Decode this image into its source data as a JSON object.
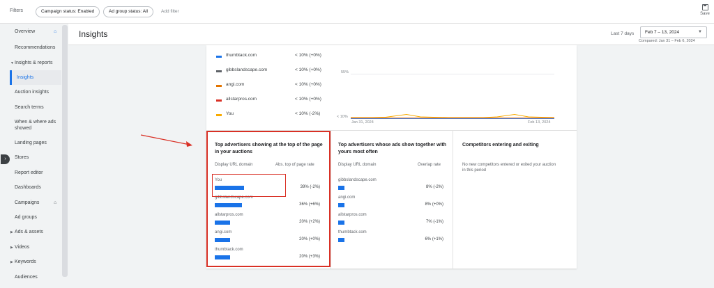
{
  "filters": {
    "label": "Filters",
    "chips": [
      "Campaign status: Enabled",
      "Ad group status: All"
    ],
    "add": "Add filter"
  },
  "save_label": "Save",
  "sidebar": {
    "items": [
      {
        "label": "Overview"
      },
      {
        "label": "Recommendations"
      },
      {
        "label": "Insights & reports"
      },
      {
        "label": "Insights"
      },
      {
        "label": "Auction insights"
      },
      {
        "label": "Search terms"
      },
      {
        "label": "When & where ads showed"
      },
      {
        "label": "Landing pages"
      },
      {
        "label": "Stores"
      },
      {
        "label": "Report editor"
      },
      {
        "label": "Dashboards"
      },
      {
        "label": "Campaigns"
      },
      {
        "label": "Ad groups"
      },
      {
        "label": "Ads & assets"
      },
      {
        "label": "Videos"
      },
      {
        "label": "Keywords"
      },
      {
        "label": "Audiences"
      }
    ]
  },
  "header": {
    "title": "Insights",
    "range_label": "Last 7 days",
    "date_range": "Feb 7 – 13, 2024",
    "compared": "Compared: Jan 31 – Feb 6, 2024"
  },
  "legend": [
    {
      "name": "thumbtack.com",
      "value": "< 10% (+0%)",
      "color": "#1a73e8"
    },
    {
      "name": "gibbslandscape.com",
      "value": "< 10% (+0%)",
      "color": "#5f6368"
    },
    {
      "name": "angi.com",
      "value": "< 10% (+0%)",
      "color": "#e37400"
    },
    {
      "name": "allstarpros.com",
      "value": "< 10% (+0%)",
      "color": "#d93025"
    },
    {
      "name": "You",
      "value": "< 10% (-2%)",
      "color": "#f9ab00"
    }
  ],
  "chart_data": {
    "type": "line",
    "y_ticks": [
      "55%",
      "< 10%"
    ],
    "x_ticks": [
      "Jan 31, 2024",
      "Feb 13, 2024"
    ]
  },
  "panels": [
    {
      "title": "Top advertisers showing at the top of the page in your auctions",
      "col1": "Display URL domain",
      "col2": "Abs. top of page rate",
      "rows": [
        {
          "domain": "You",
          "value": "39% (-2%)",
          "bar": 0.39
        },
        {
          "domain": "gibbslandscape.com",
          "value": "36% (+6%)",
          "bar": 0.36
        },
        {
          "domain": "allstarpros.com",
          "value": "20% (+2%)",
          "bar": 0.2
        },
        {
          "domain": "angi.com",
          "value": "20% (+0%)",
          "bar": 0.2
        },
        {
          "domain": "thumbtack.com",
          "value": "20% (+3%)",
          "bar": 0.2
        }
      ]
    },
    {
      "title": "Top advertisers whose ads show together with yours most often",
      "col1": "Display URL domain",
      "col2": "Overlap rate",
      "rows": [
        {
          "domain": "gibbslandscape.com",
          "value": "8% (-2%)",
          "bar": 0.08
        },
        {
          "domain": "angi.com",
          "value": "8% (+0%)",
          "bar": 0.08
        },
        {
          "domain": "allstarpros.com",
          "value": "7% (-1%)",
          "bar": 0.07
        },
        {
          "domain": "thumbtack.com",
          "value": "6% (+1%)",
          "bar": 0.06
        }
      ]
    },
    {
      "title": "Competitors entering and exiting",
      "empty": "No new competitors entered or exited your auction in this period"
    }
  ]
}
